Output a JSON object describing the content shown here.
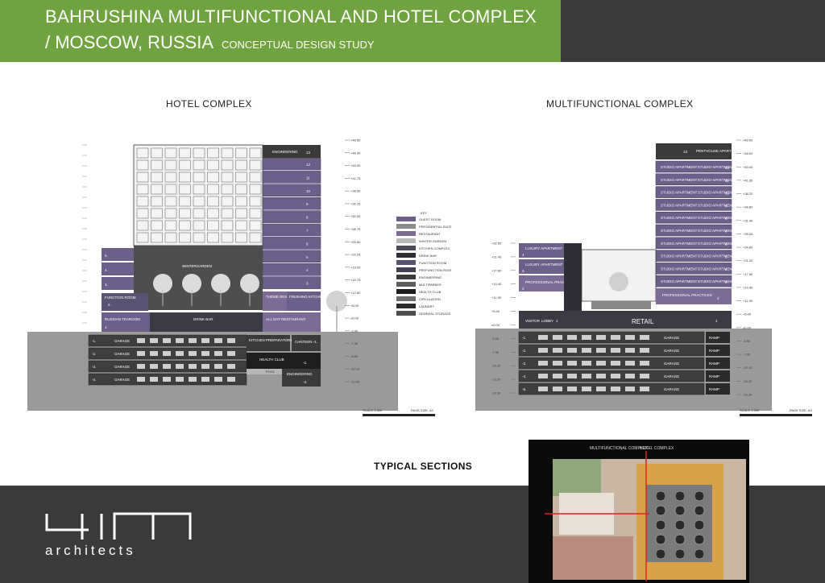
{
  "header": {
    "title_line1": "BAHRUSHINA MULTIFUNCTIONAL AND HOTEL COMPLEX",
    "title_line2": "/ MOSCOW, RUSSIA",
    "subtitle": "CONCEPTUAL DESIGN STUDY"
  },
  "sections": {
    "hotel_title": "HOTEL COMPLEX",
    "multi_title": "MULTIFUNCTIONAL COMPLEX",
    "typical_title": "TYPICAL SECTIONS"
  },
  "hotel": {
    "engineering": "ENGINEERING",
    "floors": [
      "13",
      "12",
      "11",
      "10",
      "9",
      "8",
      "7",
      "6",
      "5",
      "4",
      "3"
    ],
    "left_floors": [
      "5",
      "4",
      "3"
    ],
    "wintergarden": "WINTERGARDEN",
    "function_room": "FUNCTION ROOM",
    "function_room_num": "2.",
    "theme_restaurant": "THEME RESTAURANT",
    "finishing_kitchen": "FINISHING KITCHEN",
    "russian_tearoom": "RUSSIAN TEAROOM",
    "drink_bar": "DRINK BAR",
    "all_day_restaurant": "ALL DAY RESTAURANT",
    "ground_num": "1",
    "garage_levels": [
      "-1.",
      "-2.",
      "-3.",
      "-4."
    ],
    "garage": "GARAGE",
    "kitchen_prep": "KITCHEN PREPARATORY AREAS",
    "canteen": "CANTEEN -1.",
    "health_club": "HEALTH CLUB",
    "health_num": "-2.",
    "pool": "POOL",
    "engineering_below": "ENGINEERING",
    "eng_num": "-3.",
    "levels": [
      "+49.50",
      "+48.00",
      "+45.00",
      "+41.75",
      "+38.50",
      "+35.25",
      "+32.00",
      "+28.75",
      "+25.50",
      "+22.25",
      "+19.00",
      "+15.75",
      "+12.50",
      "+6.00",
      "±0.00",
      "-3.90",
      "-7.30",
      "-8.50",
      "-10.10",
      "-13.00"
    ],
    "scale": "SCALE 1:300",
    "page_size": "PAGE SIZE: A3"
  },
  "key": {
    "title": "KEY",
    "items": [
      {
        "label": "GUEST ROOM",
        "color": "#6c5f89"
      },
      {
        "label": "PRESIDENTIAL SUITE",
        "color": "#8a8a8a"
      },
      {
        "label": "RESTAURANT",
        "color": "#7b6b95"
      },
      {
        "label": "WINTER GARDEN",
        "color": "#b9b9b9"
      },
      {
        "label": "KITCHEN COMPLEX",
        "color": "#4a4a56"
      },
      {
        "label": "DRINK BAR",
        "color": "#2e2e36"
      },
      {
        "label": "FUNCTION ROOM",
        "color": "#5a5272"
      },
      {
        "label": "PREFUNCTION ROOM",
        "color": "#44404f"
      },
      {
        "label": "ENGINEERING",
        "color": "#3b3b3b"
      },
      {
        "label": "MULTIPARKER",
        "color": "#5e5e5e"
      },
      {
        "label": "HEALTH CLUB",
        "color": "#1e1e1e"
      },
      {
        "label": "CIRCULATION",
        "color": "#6e6e6e"
      },
      {
        "label": "LAUNDRY",
        "color": "#2a2a2a"
      },
      {
        "label": "GENERAL STORAGE",
        "color": "#4d4d4d"
      }
    ]
  },
  "multi": {
    "penthouse": "PENTHOUSE APARTMENT",
    "top_num": "13",
    "studio": "STUDIO APARTMENT",
    "floors": [
      "12",
      "11",
      "10",
      "9",
      "8",
      "7",
      "6",
      "5",
      "4",
      "3"
    ],
    "luxury": "LUXURY APARTMENT",
    "left_floors": [
      "4",
      "3"
    ],
    "professional": "PROFESSIONAL PRACTICES",
    "prof_num": "2",
    "visitor": "VISITOR",
    "lobby": "LOBBY",
    "ground_num": "1",
    "retail": "RETAIL",
    "garage": "GARAGE",
    "ramp": "RAMP",
    "garage_levels": [
      "-1.",
      "-2.",
      "-3.",
      "-4.",
      "-5."
    ],
    "levels_left": [
      "+22.50",
      "+21.40",
      "+17.80",
      "+14.40",
      "+11.00",
      "+5.00",
      "±0.00",
      "-3.90",
      "-7.30",
      "-10.10",
      "-13.20",
      "-16.30"
    ],
    "levels_right": [
      "+49.50",
      "+48.00",
      "+45.00",
      "+41.60",
      "+38.20",
      "+34.80",
      "+31.40",
      "+28.00",
      "+24.60",
      "+21.20",
      "+17.80",
      "+14.40",
      "+11.00",
      "+5.00",
      "±0.00",
      "-3.90",
      "-7.00",
      "-10.10",
      "-13.20",
      "-16.30"
    ],
    "scale": "SCALE 1:300",
    "page_size": "PAGE SIZE: A3"
  },
  "plan": {
    "label_multi": "MULTIFUNCTIONAL COMPLEX",
    "label_hotel": "HOTEL COMPLEX"
  },
  "footer": {
    "logo_mark": "4 I I",
    "logo_text": "architects"
  }
}
